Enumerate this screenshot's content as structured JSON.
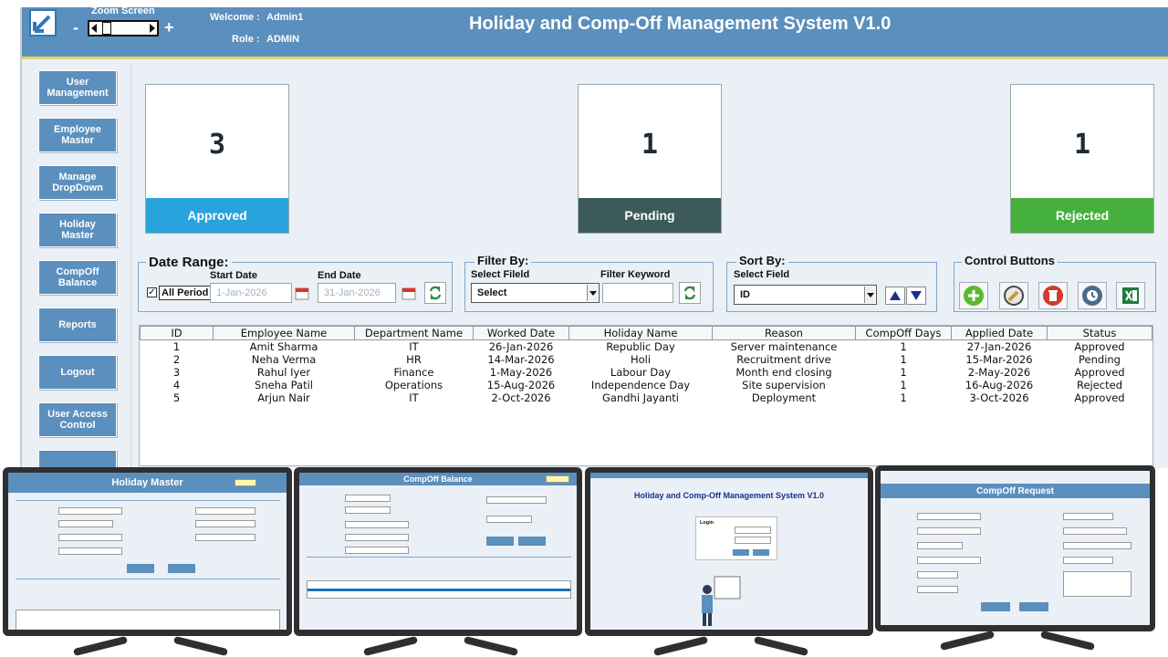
{
  "header": {
    "zoom_label": "Zoom Screen",
    "zoom_minus": "-",
    "zoom_plus": "+",
    "welcome_label": "Welcome :",
    "welcome_user": "Admin1",
    "role_label": "Role :",
    "role_value": "ADMIN",
    "title": "Holiday and Comp-Off Management System V1.0"
  },
  "sidebar": {
    "items": [
      {
        "label": "User\nManagement"
      },
      {
        "label": "Employee\nMaster"
      },
      {
        "label": "Manage\nDropDown"
      },
      {
        "label": "Holiday\nMaster"
      },
      {
        "label": "CompOff\nBalance"
      },
      {
        "label": "Reports"
      },
      {
        "label": "Logout"
      },
      {
        "label": "User Access\nControl"
      }
    ]
  },
  "cards": [
    {
      "count": "3",
      "label": "Approved",
      "color": "#29a3dc"
    },
    {
      "count": "1",
      "label": "Pending",
      "color": "#3c5a5a"
    },
    {
      "count": "1",
      "label": "Rejected",
      "color": "#46b03f"
    }
  ],
  "date_range": {
    "title": "Date Range:",
    "start_label": "Start Date",
    "end_label": "End Date",
    "all_period_label": "All Period",
    "all_period_checked": true,
    "start_value": "1-Jan-2026",
    "end_value": "31-Jan-2026"
  },
  "filter": {
    "title": "Filter By:",
    "field_label": "Select Fileld",
    "keyword_label": "Filter Keyword",
    "field_value": "Select",
    "keyword_value": ""
  },
  "sort": {
    "title": "Sort By:",
    "field_label": "Select Field",
    "field_value": "ID"
  },
  "controls": {
    "title": "Control Buttons"
  },
  "grid": {
    "columns": [
      "ID",
      "Employee Name",
      "Department Name",
      "Worked Date",
      "Holiday Name",
      "Reason",
      "CompOff Days",
      "Applied Date",
      "Status"
    ],
    "rows": [
      [
        "1",
        "Amit Sharma",
        "IT",
        "26-Jan-2026",
        "Republic Day",
        "Server maintenance",
        "1",
        "27-Jan-2026",
        "Approved"
      ],
      [
        "2",
        "Neha Verma",
        "HR",
        "14-Mar-2026",
        "Holi",
        "Recruitment drive",
        "1",
        "15-Mar-2026",
        "Pending"
      ],
      [
        "3",
        "Rahul Iyer",
        "Finance",
        "1-May-2026",
        "Labour Day",
        "Month end closing",
        "1",
        "2-May-2026",
        "Approved"
      ],
      [
        "4",
        "Sneha Patil",
        "Operations",
        "15-Aug-2026",
        "Independence Day",
        "Site supervision",
        "1",
        "16-Aug-2026",
        "Rejected"
      ],
      [
        "5",
        "Arjun Nair",
        "IT",
        "2-Oct-2026",
        "Gandhi Jayanti",
        "Deployment",
        "1",
        "3-Oct-2026",
        "Approved"
      ]
    ]
  },
  "thumbnails": [
    {
      "title": "Holiday Master"
    },
    {
      "title": "CompOff Balance"
    },
    {
      "title": "Holiday and Comp-Off Management System V1.0",
      "login_label": "Login"
    },
    {
      "title": "CompOff Request"
    }
  ],
  "colors": {
    "header_bg": "#5b8fbd",
    "accent_line": "#e8d26a",
    "approved": "#29a3dc",
    "pending": "#3c5a5a",
    "rejected": "#46b03f"
  }
}
